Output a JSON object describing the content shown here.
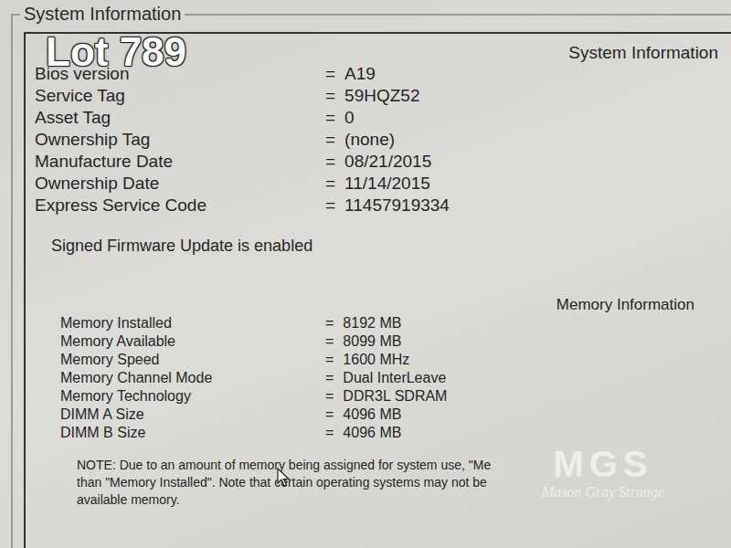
{
  "overlay_label": "Lot 789",
  "group_title": "System Information",
  "system": {
    "heading": "System Information",
    "rows": [
      {
        "label": "Bios version",
        "separator": "=",
        "value": "A19"
      },
      {
        "label": "Service Tag",
        "separator": "=",
        "value": "59HQZ52"
      },
      {
        "label": "Asset Tag",
        "separator": "=",
        "value": "0"
      },
      {
        "label": "Ownership Tag",
        "separator": "=",
        "value": "(none)"
      },
      {
        "label": "Manufacture Date",
        "separator": "=",
        "value": "08/21/2015"
      },
      {
        "label": "Ownership Date",
        "separator": "=",
        "value": "11/14/2015"
      },
      {
        "label": "Express Service Code",
        "separator": "=",
        "value": "11457919334"
      }
    ]
  },
  "firmware_note": "Signed Firmware Update is enabled",
  "memory": {
    "heading": "Memory Information",
    "rows": [
      {
        "label": "Memory Installed",
        "separator": "=",
        "value": "8192 MB"
      },
      {
        "label": "Memory Available",
        "separator": "=",
        "value": "8099 MB"
      },
      {
        "label": "Memory Speed",
        "separator": "=",
        "value": "1600 MHz"
      },
      {
        "label": "Memory Channel Mode",
        "separator": "=",
        "value": "Dual InterLeave"
      },
      {
        "label": "Memory Technology",
        "separator": "=",
        "value": "DDR3L SDRAM"
      },
      {
        "label": "DIMM A Size",
        "separator": "=",
        "value": "4096 MB"
      },
      {
        "label": "DIMM B Size",
        "separator": "=",
        "value": "4096 MB"
      }
    ]
  },
  "note_lines": [
    "NOTE: Due to an amount of memory being assigned for system use, \"Me",
    "than \"Memory Installed\". Note that certain operating systems may not be",
    "available memory."
  ],
  "watermark": {
    "logo": "MGS",
    "name": "Mason Gray Strange"
  }
}
